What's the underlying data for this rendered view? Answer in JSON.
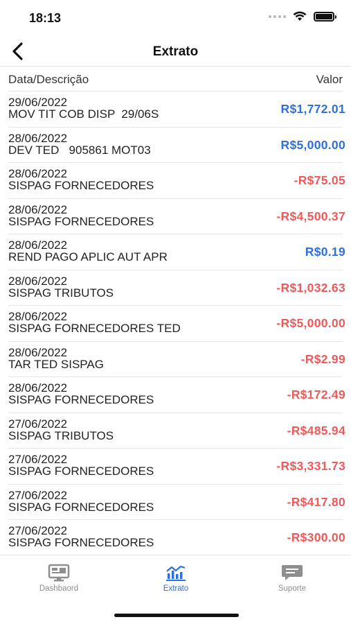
{
  "status_bar": {
    "time": "18:13"
  },
  "nav": {
    "title": "Extrato"
  },
  "columns": {
    "left": "Data/Descrição",
    "right": "Valor"
  },
  "transactions": [
    {
      "date": "29/06/2022",
      "description": "MOV TIT COB DISP  29/06S",
      "amount": "R$1,772.01",
      "type": "positive"
    },
    {
      "date": "28/06/2022",
      "description": "DEV TED   905861 MOT03",
      "amount": "R$5,000.00",
      "type": "positive"
    },
    {
      "date": "28/06/2022",
      "description": "SISPAG FORNECEDORES",
      "amount": "-R$75.05",
      "type": "negative"
    },
    {
      "date": "28/06/2022",
      "description": "SISPAG FORNECEDORES",
      "amount": "-R$4,500.37",
      "type": "negative"
    },
    {
      "date": "28/06/2022",
      "description": "REND PAGO APLIC AUT APR",
      "amount": "R$0.19",
      "type": "positive"
    },
    {
      "date": "28/06/2022",
      "description": "SISPAG TRIBUTOS",
      "amount": "-R$1,032.63",
      "type": "negative"
    },
    {
      "date": "28/06/2022",
      "description": "SISPAG FORNECEDORES TED",
      "amount": "-R$5,000.00",
      "type": "negative"
    },
    {
      "date": "28/06/2022",
      "description": "TAR TED SISPAG",
      "amount": "-R$2.99",
      "type": "negative"
    },
    {
      "date": "28/06/2022",
      "description": "SISPAG FORNECEDORES",
      "amount": "-R$172.49",
      "type": "negative"
    },
    {
      "date": "27/06/2022",
      "description": "SISPAG TRIBUTOS",
      "amount": "-R$485.94",
      "type": "negative"
    },
    {
      "date": "27/06/2022",
      "description": "SISPAG FORNECEDORES",
      "amount": "-R$3,331.73",
      "type": "negative"
    },
    {
      "date": "27/06/2022",
      "description": "SISPAG FORNECEDORES",
      "amount": "-R$417.80",
      "type": "negative"
    },
    {
      "date": "27/06/2022",
      "description": "SISPAG FORNECEDORES",
      "amount": "-R$300.00",
      "type": "negative"
    }
  ],
  "tab_bar": {
    "tabs": [
      {
        "label": "Dashbaord",
        "icon": "monitor-icon",
        "active": false
      },
      {
        "label": "Extrato",
        "icon": "chart-icon",
        "active": true
      },
      {
        "label": "Suporte",
        "icon": "chat-icon",
        "active": false
      }
    ]
  },
  "colors": {
    "positive": "#2f6fe0",
    "negative": "#ee5a5a",
    "active_tab": "#2f6fe0",
    "inactive_tab": "#8e8e8e"
  }
}
